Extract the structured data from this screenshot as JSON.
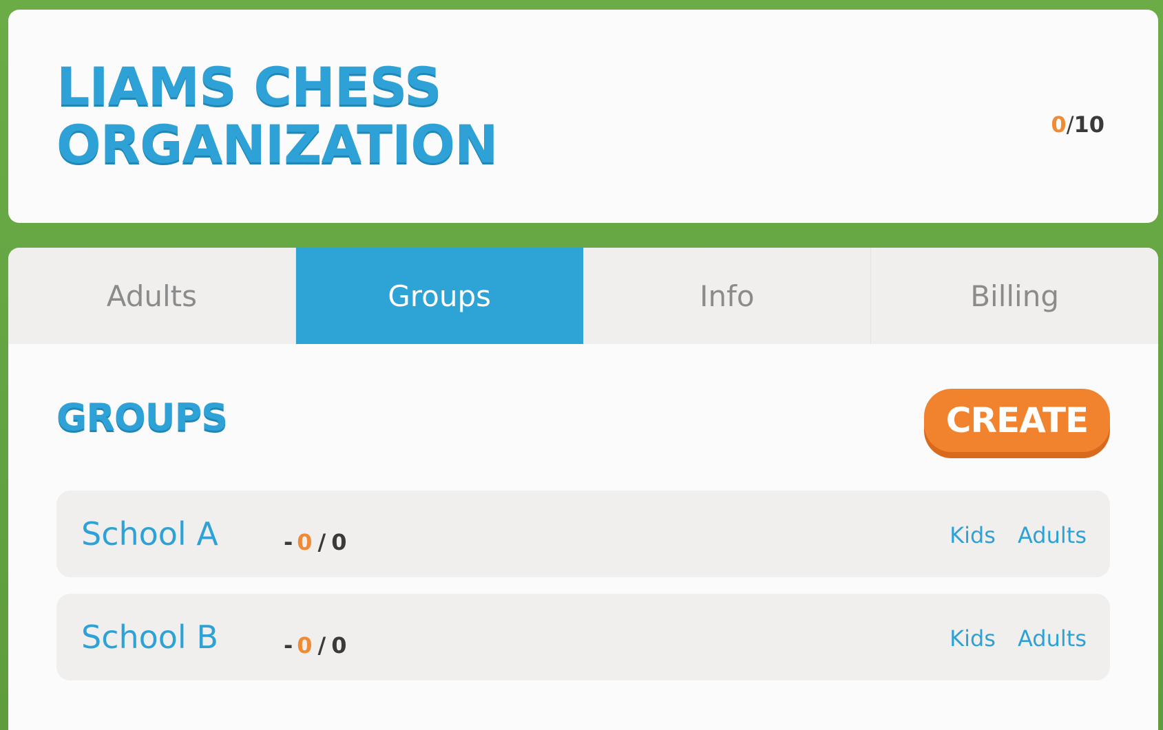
{
  "header": {
    "org_name_line1": "Liams Chess",
    "org_name_line2": "Organization",
    "count_used": "0",
    "count_sep": "/",
    "count_total": "10"
  },
  "tabs": [
    {
      "label": "Adults",
      "active": false
    },
    {
      "label": "Groups",
      "active": true
    },
    {
      "label": "Info",
      "active": false
    },
    {
      "label": "Billing",
      "active": false
    }
  ],
  "section": {
    "title": "Groups",
    "create_label": "Create"
  },
  "groups": [
    {
      "name": "School A",
      "dash": "-",
      "used": "0",
      "slash": "/",
      "total": "0",
      "kids_label": "Kids",
      "adults_label": "Adults"
    },
    {
      "name": "School B",
      "dash": "-",
      "used": "0",
      "slash": "/",
      "total": "0",
      "kids_label": "Kids",
      "adults_label": "Adults"
    }
  ],
  "colors": {
    "background_green": "#64a343",
    "accent_blue": "#2ea2d6",
    "accent_orange": "#f2832e",
    "card": "#fbfbfb",
    "row": "#f0efed"
  }
}
